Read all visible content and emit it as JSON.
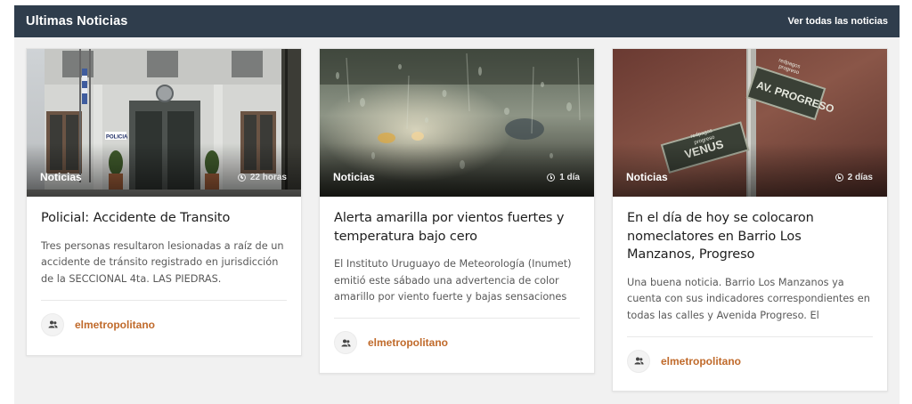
{
  "header": {
    "title": "Ultimas Noticias",
    "view_all": "Ver todas las noticias"
  },
  "cards": [
    {
      "category": "Noticias",
      "time": "22 horas",
      "title": "Policial: Accidente de Transito",
      "excerpt": "Tres personas resultaron lesionadas a raíz de un accidente de tránsito registrado en jurisdicción de la SECCIONAL 4ta. LAS PIEDRAS.",
      "author": "elmetropolitano",
      "image": "police-station-facade",
      "sign_text": "POLICIA"
    },
    {
      "category": "Noticias",
      "time": "1 día",
      "title": "Alerta amarilla por vientos fuertes y temperatura bajo cero",
      "excerpt": "El Instituto Uruguayo de Meteorología (Inumet) emitió este sábado una advertencia de color amarillo por viento fuerte y bajas sensaciones",
      "author": "elmetropolitano",
      "image": "rain-on-window"
    },
    {
      "category": "Noticias",
      "time": "2 días",
      "title": "En el día de hoy se colocaron nomeclatores en Barrio Los Manzanos, Progreso",
      "excerpt": "Una buena noticia. Barrio Los Manzanos ya cuenta  con sus indicadores correspondientes en todas las calles y Avenida Progreso.    El",
      "author": "elmetropolitano",
      "image": "street-signs",
      "sign_top": "AV. PROGRESO",
      "sign_bottom": "VENUS",
      "sign_brand_top": "redpagos",
      "sign_brand_bottom": "progreso"
    }
  ],
  "colors": {
    "header_bg": "#2f3d4c",
    "author": "#c06a2b",
    "section_bg": "#f1f1f1"
  }
}
